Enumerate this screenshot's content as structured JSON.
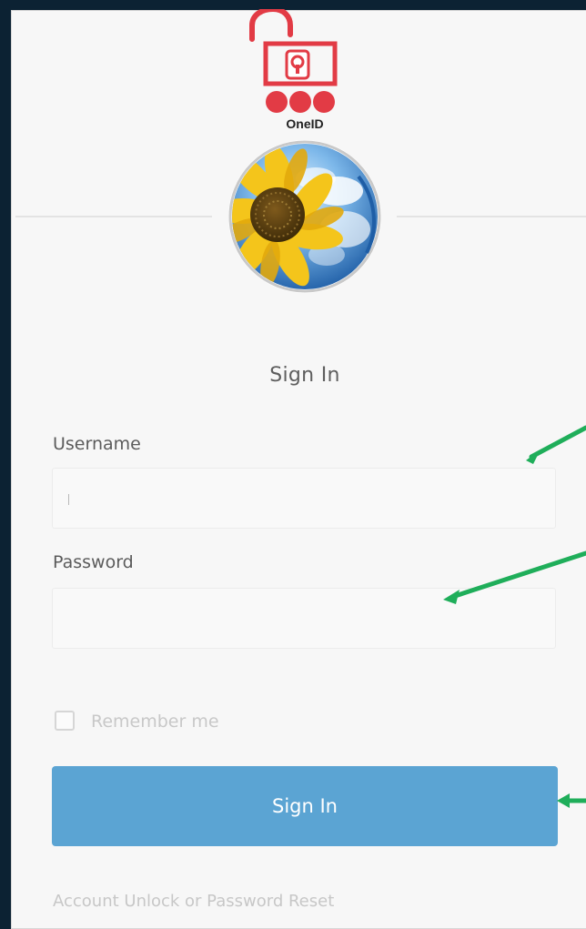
{
  "logo": {
    "text": "OneID"
  },
  "header": {
    "title": "Sign In"
  },
  "form": {
    "username_label": "Username",
    "password_label": "Password",
    "username_value": "",
    "password_value": "",
    "remember_label": "Remember me",
    "submit_label": "Sign In"
  },
  "footer": {
    "reset_link": "Account Unlock or Password Reset"
  },
  "colors": {
    "background": "#0c2233",
    "card": "#f7f7f7",
    "button": "#5ba4d3",
    "arrow": "#1fae5a",
    "logo_red": "#e23b45"
  }
}
